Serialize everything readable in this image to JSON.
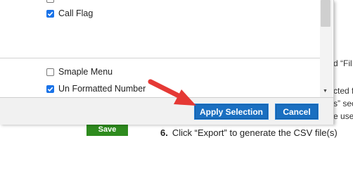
{
  "modal": {
    "top_items": [
      {
        "label": "Call Flag",
        "checked": true
      }
    ],
    "bottom_items": [
      {
        "label": "Smaple Menu",
        "checked": false
      },
      {
        "label": "Un Formatted Number",
        "checked": true
      }
    ],
    "footer": {
      "apply_label": "Apply Selection",
      "cancel_label": "Cancel"
    }
  },
  "background": {
    "snippets": [
      "d “Fil",
      "cted f",
      "s” sec",
      "e use"
    ],
    "save_label": "Save",
    "step_number": "6.",
    "step_text": "Click “Export” to generate the CSV file(s)"
  },
  "colors": {
    "accent": "#1a6fc1",
    "checkbox": "#1a73e8",
    "save_green": "#2e8b1e",
    "annotation_arrow": "#e53935"
  }
}
